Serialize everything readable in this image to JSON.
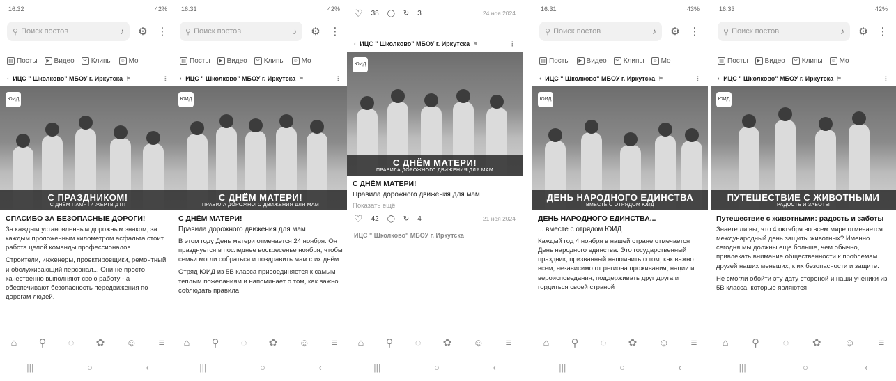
{
  "search_placeholder": "Поиск постов",
  "tabs": [
    "Посты",
    "Видео",
    "Клипы",
    "Мо"
  ],
  "author": "ИЦС \" Школково\" МБОУ г. Иркутска",
  "bottom_nav_icons": [
    "home-icon",
    "search-icon",
    "messages-icon",
    "clips-icon",
    "profile-icon",
    "menu-icon"
  ],
  "system_nav_icons": [
    "recent-apps-icon",
    "home-circle-icon",
    "back-icon"
  ],
  "screens": [
    {
      "status_time": "16:32",
      "status_battery": "42%",
      "photo_big": "С ПРАЗДНИКОМ!",
      "photo_small": "С ДНЁМ ПАМЯТИ ЖЕРТВ ДТП",
      "title": "СПАСИБО ЗА БЕЗОПАСНЫЕ ДОРОГИ!",
      "subtitle": "",
      "paragraphs": [
        "За каждым установленным дорожным знаком, за каждым проложенным километром асфальта стоит работа целой команды профессионалов.",
        "Строители, инженеры, проектировщики, ремонтный и обслуживающий персонал... Они не просто качественно выполняют свою работу - а обеспечивают безопасность передвижения по дорогам людей."
      ]
    },
    {
      "status_time": "16:31",
      "status_battery": "42%",
      "photo_big": "С ДНЁМ МАТЕРИ!",
      "photo_small": "ПРАВИЛА ДОРОЖНОГО ДВИЖЕНИЯ ДЛЯ МАМ",
      "title": "С ДНЁМ МАТЕРИ!",
      "subtitle": "Правила дорожного движения для мам",
      "paragraphs": [
        "В этом году День матери отмечается 24 ноября. Он празднуется в последнее воскресенье ноября, чтобы семьи могли собраться и поздравить мам с их днём",
        "Отряд ЮИД из 5В класса присоединяется к самым теплым пожеланиям и напоминает о том, как важно соблюдать правила"
      ]
    },
    {
      "status_time": "16:30",
      "status_battery": "43%",
      "top_likes": "38",
      "top_reposts": "3",
      "top_date": "24 ноя 2024",
      "photo_big": "С ДНЁМ МАТЕРИ!",
      "photo_small": "ПРАВИЛА ДОРОЖНОГО ДВИЖЕНИЯ ДЛЯ МАМ",
      "title": "С ДНЁМ МАТЕРИ!",
      "subtitle": "Правила дорожного движения для мам",
      "show_more": "Показать ещё",
      "likes": "42",
      "reposts": "4",
      "date": "21 ноя 2024"
    },
    {
      "status_time": "16:31",
      "status_battery": "43%",
      "photo_big": "ДЕНЬ НАРОДНОГО ЕДИНСТВА",
      "photo_small": "ВМЕСТЕ С ОТРЯДОМ ЮИД",
      "title": "ДЕНЬ НАРОДНОГО ЕДИНСТВА...",
      "subtitle": "... вместе с отрядом ЮИД",
      "paragraphs": [
        "Каждый год 4 ноября в нашей стране отмечается День народного единства. Это государственный праздник, призванный напомнить о том, как важно всем, независимо от региона проживания, нации и вероисповедания, поддерживать друг друга и гордиться своей страной"
      ]
    },
    {
      "status_time": "16:33",
      "status_battery": "42%",
      "photo_big": "ПУТЕШЕСТВИЕ С ЖИВОТНЫМИ",
      "photo_small": "РАДОСТЬ И ЗАБОТЫ",
      "title": "Путешествие с животными: радость и заботы",
      "subtitle": "",
      "paragraphs": [
        "Знаете ли вы, что 4 октября во всем мире отмечается международный день защиты животных? Именно сегодня мы должны еще больше, чем обычно, привлекать внимание общественности к проблемам друзей наших меньших, к их безопасности и защите.",
        "Не смогли обойти эту дату стороной и наши ученики из 5В класса, которые являются"
      ]
    }
  ]
}
